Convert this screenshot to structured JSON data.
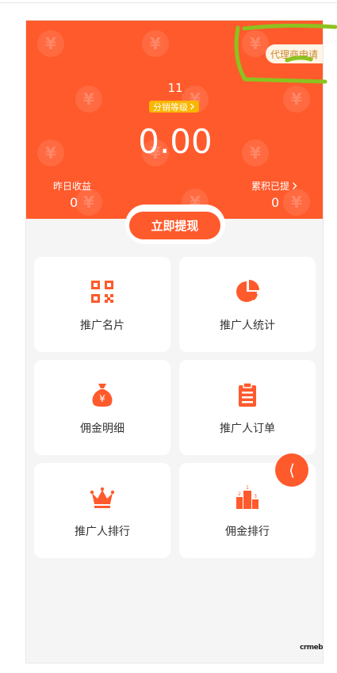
{
  "header": {
    "agent_apply_label": "代理商申请",
    "level_number": "11",
    "level_badge": "分销等级",
    "balance": "0.00",
    "yesterday_label": "昨日收益",
    "yesterday_value": "0",
    "total_label": "累积已提",
    "total_value": "0"
  },
  "withdraw_label": "立即提现",
  "menu": [
    {
      "label": "推广名片",
      "icon": "qrcode-icon"
    },
    {
      "label": "推广人统计",
      "icon": "pie-chart-icon"
    },
    {
      "label": "佣金明细",
      "icon": "money-bag-icon"
    },
    {
      "label": "推广人订单",
      "icon": "clipboard-icon"
    },
    {
      "label": "推广人排行",
      "icon": "crown-icon"
    },
    {
      "label": "佣金排行",
      "icon": "podium-icon"
    }
  ],
  "back_glyph": "⟨",
  "watermark_glyph": "¥",
  "logo_text": "crmeb",
  "colors": {
    "primary": "#ff5a2c",
    "badge": "#f8b700",
    "agent_bg": "#fff5e6",
    "agent_text": "#c98a2e",
    "annotation": "#8dc21f"
  }
}
